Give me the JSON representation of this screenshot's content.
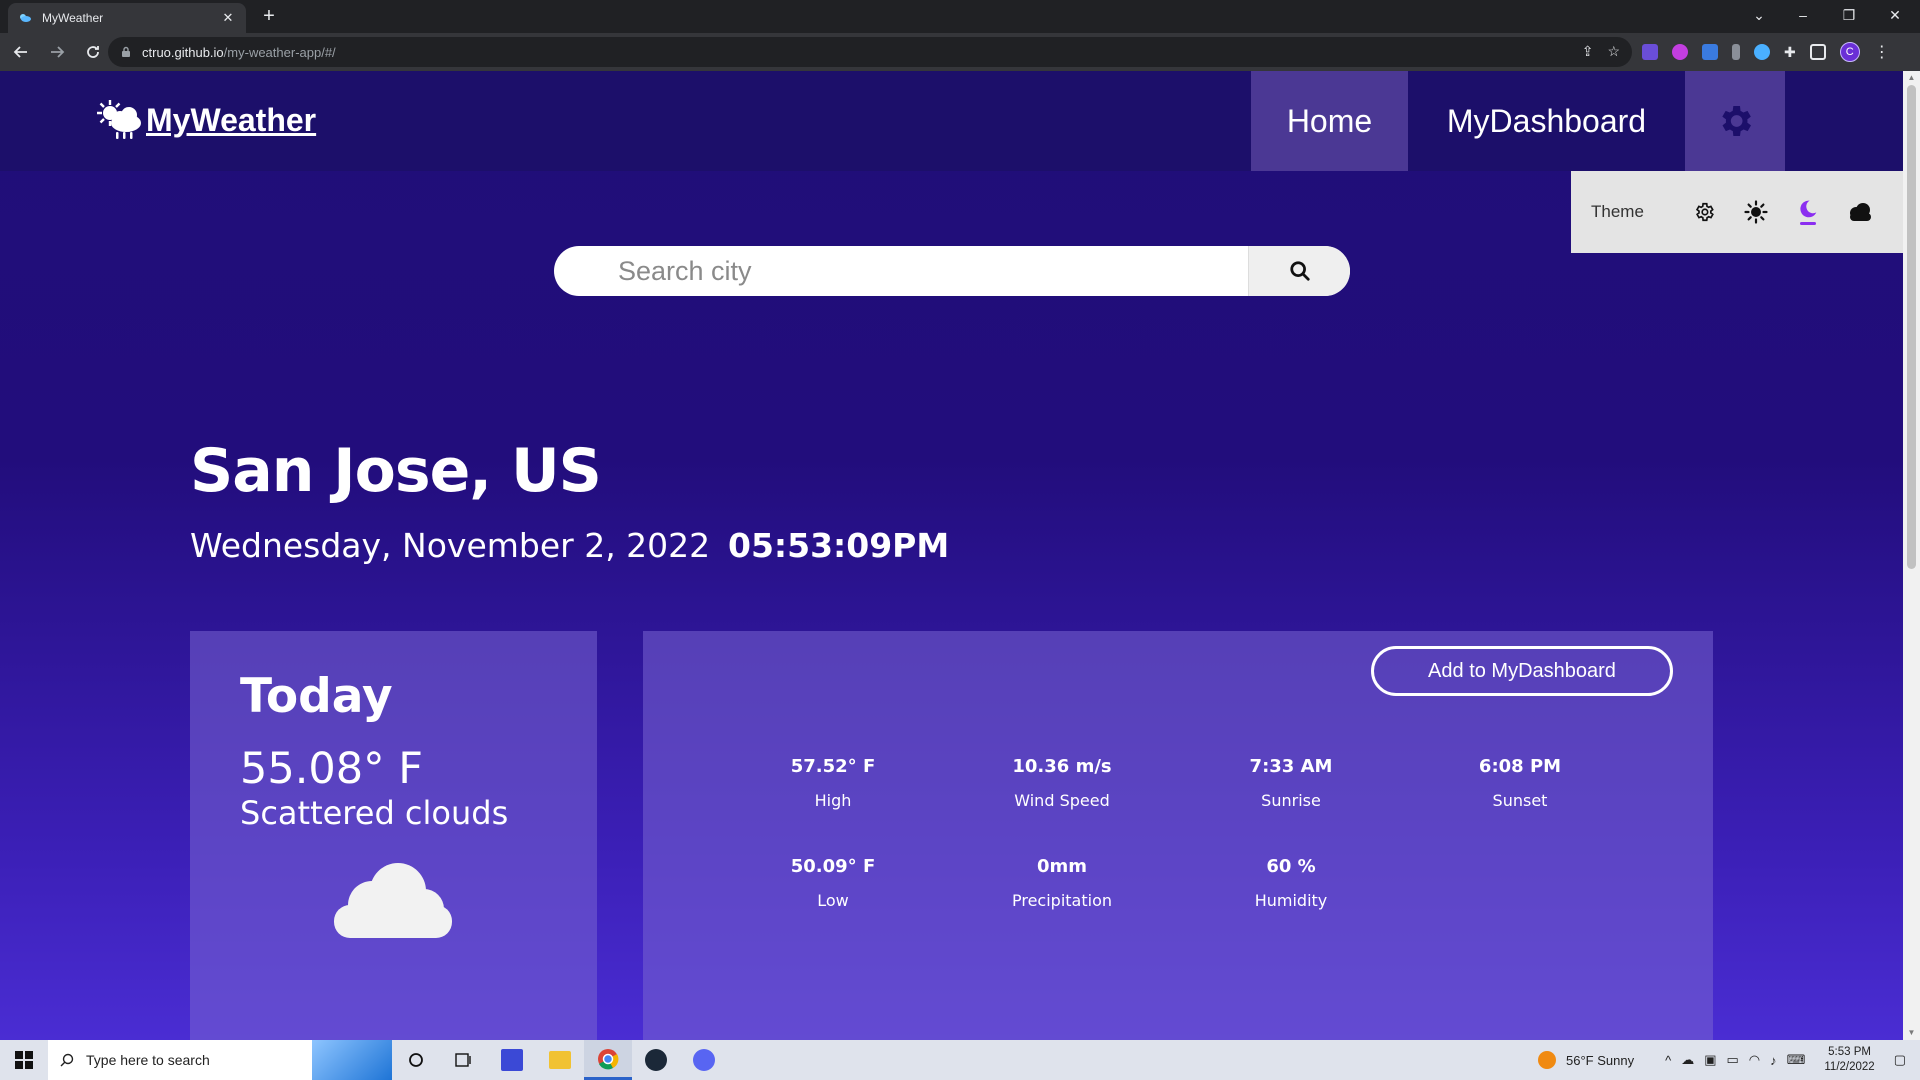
{
  "browser": {
    "tab_title": "MyWeather",
    "tab_close": "✕",
    "new_tab": "+",
    "url_host": "ctruo.github.io",
    "url_path": "/my-weather-app/#/",
    "profile_initial": "C"
  },
  "nav": {
    "logo_text": "MyWeather",
    "home_label": "Home",
    "dashboard_label": "MyDashboard"
  },
  "theme_panel": {
    "label": "Theme",
    "options": [
      "system-icon",
      "sun-icon",
      "moon-icon",
      "cloud-icon"
    ],
    "selected": "moon-icon",
    "accent_color": "#8b2ef0"
  },
  "search": {
    "placeholder": "Search city",
    "value": ""
  },
  "location": {
    "city": "San Jose, US",
    "date": "Wednesday, November 2, 2022",
    "time": "05:53:09PM"
  },
  "today": {
    "title": "Today",
    "temperature": "55.08° F",
    "description": "Scattered clouds",
    "icon": "cloud-icon"
  },
  "details": {
    "add_button": "Add to MyDashboard",
    "stats": [
      {
        "value": "57.52° F",
        "label": "High"
      },
      {
        "value": "10.36 m/s",
        "label": "Wind Speed"
      },
      {
        "value": "7:33 AM",
        "label": "Sunrise"
      },
      {
        "value": "6:08 PM",
        "label": "Sunset"
      },
      {
        "value": "50.09° F",
        "label": "Low"
      },
      {
        "value": "0mm",
        "label": "Precipitation"
      },
      {
        "value": "60 %",
        "label": "Humidity"
      }
    ]
  },
  "taskbar": {
    "search_placeholder": "Type here to search",
    "weather": "56°F  Sunny",
    "time": "5:53 PM",
    "date": "11/2/2022"
  },
  "colors": {
    "page_bg_top": "#200e78",
    "page_bg_bottom": "#4a2dd3",
    "nav_bg": "#1c0f6a",
    "nav_active": "#4b3894",
    "card_bg": "#6c58cf"
  }
}
